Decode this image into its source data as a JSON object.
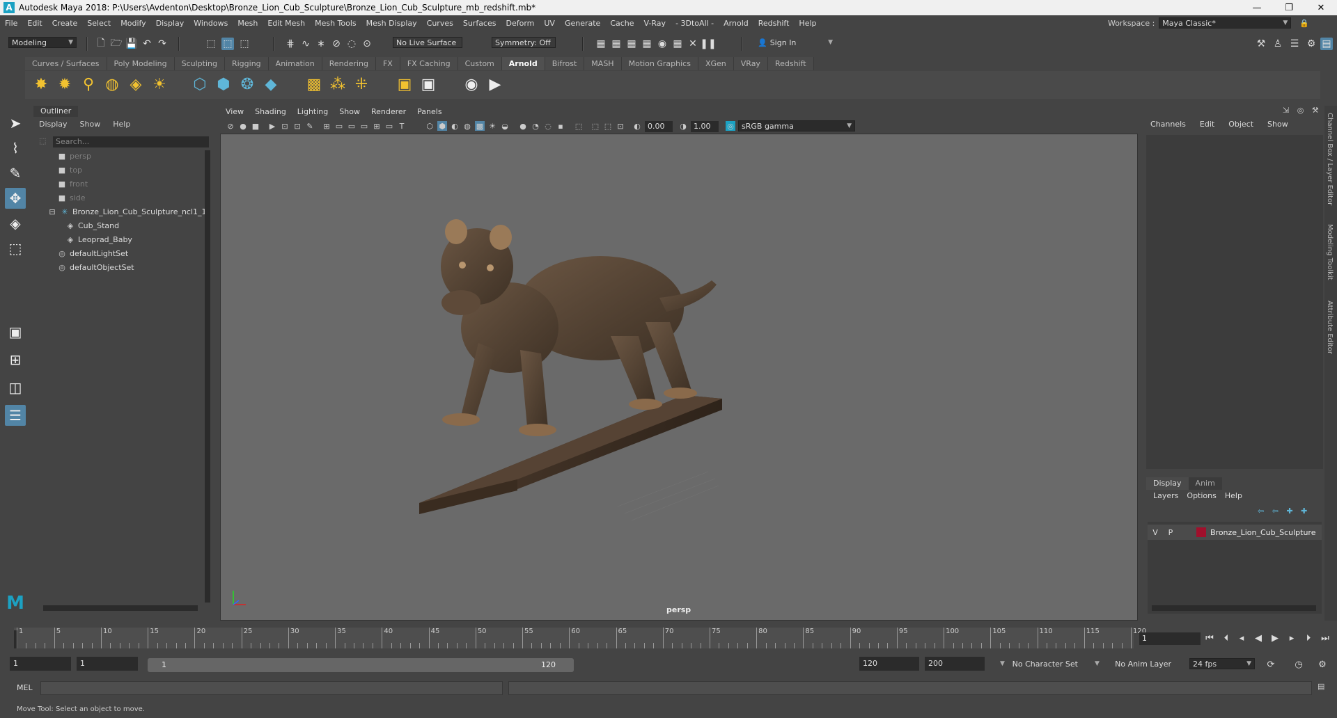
{
  "window": {
    "title": "Autodesk Maya 2018: P:\\Users\\Avdenton\\Desktop\\Bronze_Lion_Cub_Sculpture\\Bronze_Lion_Cub_Sculpture_mb_redshift.mb*",
    "logo": "A",
    "minimize": "—",
    "maximize": "❐",
    "close": "✕"
  },
  "menubar": {
    "items": [
      "File",
      "Edit",
      "Create",
      "Select",
      "Modify",
      "Display",
      "Windows",
      "Mesh",
      "Edit Mesh",
      "Mesh Tools",
      "Mesh Display",
      "Curves",
      "Surfaces",
      "Deform",
      "UV",
      "Generate",
      "Cache",
      "V-Ray",
      "- 3DtoAll -",
      "Arnold",
      "Redshift",
      "Help"
    ],
    "workspace_label": "Workspace :",
    "workspace_value": "Maya Classic*"
  },
  "statusline": {
    "mode": "Modeling",
    "live_surface": "No Live Surface",
    "symmetry": "Symmetry: Off",
    "sign_in": "Sign In"
  },
  "shelf": {
    "tabs": [
      "Curves / Surfaces",
      "Poly Modeling",
      "Sculpting",
      "Rigging",
      "Animation",
      "Rendering",
      "FX",
      "FX Caching",
      "Custom",
      "Arnold",
      "Bifrost",
      "MASH",
      "Motion Graphics",
      "XGen",
      "VRay",
      "Redshift"
    ],
    "active_tab": "Arnold"
  },
  "outliner": {
    "title": "Outliner",
    "menu": [
      "Display",
      "Show",
      "Help"
    ],
    "search_placeholder": "Search...",
    "items": [
      {
        "label": "persp",
        "dim": true
      },
      {
        "label": "top",
        "dim": true
      },
      {
        "label": "front",
        "dim": true
      },
      {
        "label": "side",
        "dim": true
      },
      {
        "label": "Bronze_Lion_Cub_Sculpture_ncl1_1",
        "dim": false
      },
      {
        "label": "Cub_Stand",
        "dim": false
      },
      {
        "label": "Leoprad_Baby",
        "dim": false
      },
      {
        "label": "defaultLightSet",
        "dim": false
      },
      {
        "label": "defaultObjectSet",
        "dim": false
      }
    ]
  },
  "viewport": {
    "menu": [
      "View",
      "Shading",
      "Lighting",
      "Show",
      "Renderer",
      "Panels"
    ],
    "exposure": "0.00",
    "gamma": "1.00",
    "color_space": "sRGB gamma",
    "camera": "persp"
  },
  "channelbox": {
    "menu": [
      "Channels",
      "Edit",
      "Object",
      "Show"
    ],
    "layer_tabs": [
      "Display",
      "Anim"
    ],
    "layer_menu": [
      "Layers",
      "Options",
      "Help"
    ],
    "layer": {
      "v": "V",
      "p": "P",
      "name": "Bronze_Lion_Cub_Sculpture",
      "color": "#a0102c"
    },
    "side_tabs": [
      "Channel Box / Layer Editor",
      "Modeling Toolkit",
      "Attribute Editor"
    ]
  },
  "timeslider": {
    "ticks": [
      "1",
      "5",
      "10",
      "15",
      "20",
      "25",
      "30",
      "35",
      "40",
      "45",
      "50",
      "55",
      "60",
      "65",
      "70",
      "75",
      "80",
      "85",
      "90",
      "95",
      "100",
      "105",
      "110",
      "115",
      "120"
    ],
    "current_frame": "1"
  },
  "rangeslider": {
    "start": "1",
    "anim_start": "1",
    "range_start": "1",
    "range_end": "120",
    "end": "120",
    "anim_end": "200",
    "character_set": "No Character Set",
    "anim_layer": "No Anim Layer",
    "fps": "24 fps"
  },
  "cmdline": {
    "label": "MEL"
  },
  "helpline": {
    "text": "Move Tool: Select an object to move."
  }
}
